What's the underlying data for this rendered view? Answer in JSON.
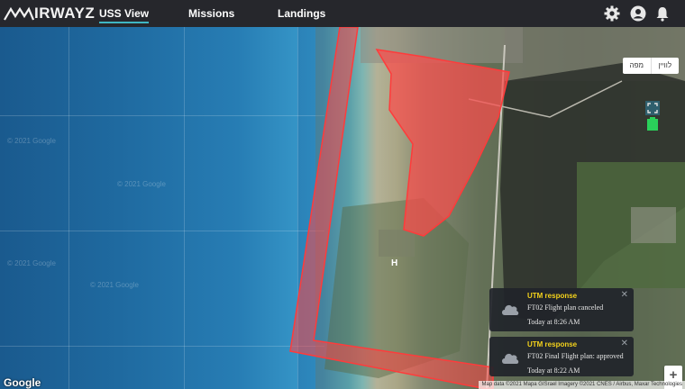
{
  "header": {
    "logo_text": "IRWAYZ",
    "nav": [
      {
        "label": "USS View",
        "active": true
      },
      {
        "label": "Missions",
        "active": false
      },
      {
        "label": "Landings",
        "active": false
      }
    ],
    "icons": [
      "gear-icon",
      "account-icon",
      "bell-icon"
    ]
  },
  "map": {
    "type_buttons": [
      "מפה",
      "לוויין"
    ],
    "watermark": "© 2021 Google",
    "google_label": "Google",
    "attribution": "Map data ©2021 Mapa GISrael Imagery ©2021 CNES / Airbus, Maxar Technologies",
    "helipad_label": "H",
    "zoom_in": "+",
    "zoom_out": "−",
    "zone_color": "#ff4a4a"
  },
  "notifications": [
    {
      "title": "UTM response",
      "message": "FT02 Flight plan canceled",
      "time": "Today at 8:26 AM"
    },
    {
      "title": "UTM response",
      "message": "FT02 Final Flight plan: approved",
      "time": "Today at 8:22 AM"
    }
  ],
  "colors": {
    "accent": "#3fb6c3",
    "toast_title": "#f4d21b",
    "topbar": "#26272c"
  }
}
